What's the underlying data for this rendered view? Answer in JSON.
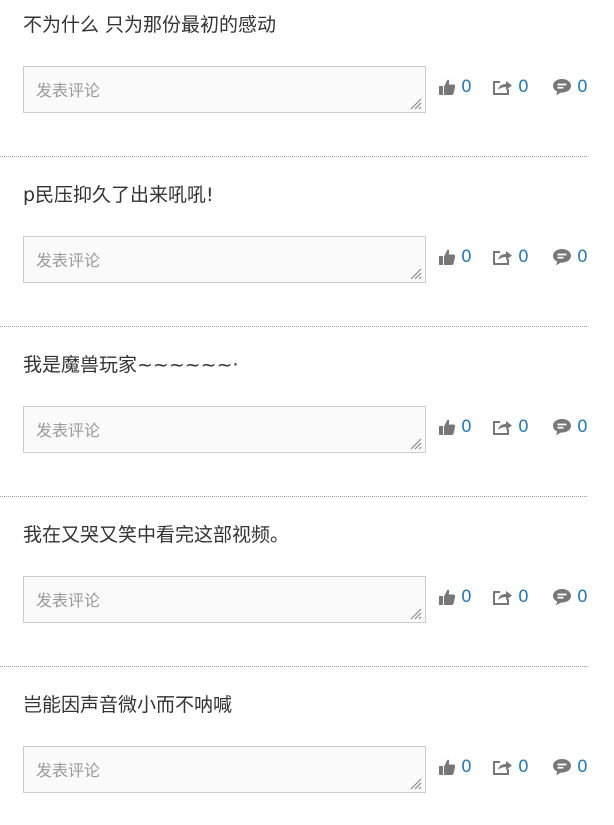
{
  "comments": [
    {
      "text": "不为什么 只为那份最初的感动",
      "placeholder": "发表评论",
      "likes": "0",
      "shares": "0",
      "replies": "0"
    },
    {
      "text": "p民压抑久了出来吼吼!",
      "placeholder": "发表评论",
      "likes": "0",
      "shares": "0",
      "replies": "0"
    },
    {
      "text": "我是魔兽玩家~~~~~~·",
      "placeholder": "发表评论",
      "likes": "0",
      "shares": "0",
      "replies": "0"
    },
    {
      "text": "我在又哭又笑中看完这部视频。",
      "placeholder": "发表评论",
      "likes": "0",
      "shares": "0",
      "replies": "0"
    },
    {
      "text": "岂能因声音微小而不呐喊",
      "placeholder": "发表评论",
      "likes": "0",
      "shares": "0",
      "replies": "0"
    }
  ],
  "colors": {
    "text": "#333333",
    "count": "#2a7ab0",
    "icon": "#777777",
    "divider": "#9a9a9a",
    "input_border": "#cccccc",
    "input_bg": "#fafafa"
  },
  "icons": {
    "like": "thumbs-up-icon",
    "share": "share-icon",
    "reply": "comment-bubble-icon",
    "grip": "resize-grip-icon"
  }
}
